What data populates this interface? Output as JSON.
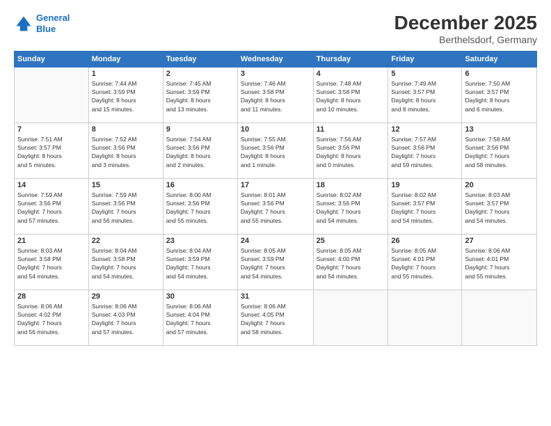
{
  "header": {
    "logo_line1": "General",
    "logo_line2": "Blue",
    "title": "December 2025",
    "subtitle": "Berthelsdorf, Germany"
  },
  "calendar": {
    "days_of_week": [
      "Sunday",
      "Monday",
      "Tuesday",
      "Wednesday",
      "Thursday",
      "Friday",
      "Saturday"
    ],
    "weeks": [
      [
        {
          "day": "",
          "info": ""
        },
        {
          "day": "1",
          "info": "Sunrise: 7:44 AM\nSunset: 3:59 PM\nDaylight: 8 hours\nand 15 minutes."
        },
        {
          "day": "2",
          "info": "Sunrise: 7:45 AM\nSunset: 3:59 PM\nDaylight: 8 hours\nand 13 minutes."
        },
        {
          "day": "3",
          "info": "Sunrise: 7:46 AM\nSunset: 3:58 PM\nDaylight: 8 hours\nand 11 minutes."
        },
        {
          "day": "4",
          "info": "Sunrise: 7:48 AM\nSunset: 3:58 PM\nDaylight: 8 hours\nand 10 minutes."
        },
        {
          "day": "5",
          "info": "Sunrise: 7:49 AM\nSunset: 3:57 PM\nDaylight: 8 hours\nand 8 minutes."
        },
        {
          "day": "6",
          "info": "Sunrise: 7:50 AM\nSunset: 3:57 PM\nDaylight: 8 hours\nand 6 minutes."
        }
      ],
      [
        {
          "day": "7",
          "info": "Sunrise: 7:51 AM\nSunset: 3:57 PM\nDaylight: 8 hours\nand 5 minutes."
        },
        {
          "day": "8",
          "info": "Sunrise: 7:52 AM\nSunset: 3:56 PM\nDaylight: 8 hours\nand 3 minutes."
        },
        {
          "day": "9",
          "info": "Sunrise: 7:54 AM\nSunset: 3:56 PM\nDaylight: 8 hours\nand 2 minutes."
        },
        {
          "day": "10",
          "info": "Sunrise: 7:55 AM\nSunset: 3:56 PM\nDaylight: 8 hours\nand 1 minute."
        },
        {
          "day": "11",
          "info": "Sunrise: 7:56 AM\nSunset: 3:56 PM\nDaylight: 8 hours\nand 0 minutes."
        },
        {
          "day": "12",
          "info": "Sunrise: 7:57 AM\nSunset: 3:56 PM\nDaylight: 7 hours\nand 59 minutes."
        },
        {
          "day": "13",
          "info": "Sunrise: 7:58 AM\nSunset: 3:56 PM\nDaylight: 7 hours\nand 58 minutes."
        }
      ],
      [
        {
          "day": "14",
          "info": "Sunrise: 7:59 AM\nSunset: 3:56 PM\nDaylight: 7 hours\nand 57 minutes."
        },
        {
          "day": "15",
          "info": "Sunrise: 7:59 AM\nSunset: 3:56 PM\nDaylight: 7 hours\nand 56 minutes."
        },
        {
          "day": "16",
          "info": "Sunrise: 8:00 AM\nSunset: 3:56 PM\nDaylight: 7 hours\nand 55 minutes."
        },
        {
          "day": "17",
          "info": "Sunrise: 8:01 AM\nSunset: 3:56 PM\nDaylight: 7 hours\nand 55 minutes."
        },
        {
          "day": "18",
          "info": "Sunrise: 8:02 AM\nSunset: 3:56 PM\nDaylight: 7 hours\nand 54 minutes."
        },
        {
          "day": "19",
          "info": "Sunrise: 8:02 AM\nSunset: 3:57 PM\nDaylight: 7 hours\nand 54 minutes."
        },
        {
          "day": "20",
          "info": "Sunrise: 8:03 AM\nSunset: 3:57 PM\nDaylight: 7 hours\nand 54 minutes."
        }
      ],
      [
        {
          "day": "21",
          "info": "Sunrise: 8:03 AM\nSunset: 3:58 PM\nDaylight: 7 hours\nand 54 minutes."
        },
        {
          "day": "22",
          "info": "Sunrise: 8:04 AM\nSunset: 3:58 PM\nDaylight: 7 hours\nand 54 minutes."
        },
        {
          "day": "23",
          "info": "Sunrise: 8:04 AM\nSunset: 3:59 PM\nDaylight: 7 hours\nand 54 minutes."
        },
        {
          "day": "24",
          "info": "Sunrise: 8:05 AM\nSunset: 3:59 PM\nDaylight: 7 hours\nand 54 minutes."
        },
        {
          "day": "25",
          "info": "Sunrise: 8:05 AM\nSunset: 4:00 PM\nDaylight: 7 hours\nand 54 minutes."
        },
        {
          "day": "26",
          "info": "Sunrise: 8:05 AM\nSunset: 4:01 PM\nDaylight: 7 hours\nand 55 minutes."
        },
        {
          "day": "27",
          "info": "Sunrise: 8:06 AM\nSunset: 4:01 PM\nDaylight: 7 hours\nand 55 minutes."
        }
      ],
      [
        {
          "day": "28",
          "info": "Sunrise: 8:06 AM\nSunset: 4:02 PM\nDaylight: 7 hours\nand 56 minutes."
        },
        {
          "day": "29",
          "info": "Sunrise: 8:06 AM\nSunset: 4:03 PM\nDaylight: 7 hours\nand 57 minutes."
        },
        {
          "day": "30",
          "info": "Sunrise: 8:06 AM\nSunset: 4:04 PM\nDaylight: 7 hours\nand 57 minutes."
        },
        {
          "day": "31",
          "info": "Sunrise: 8:06 AM\nSunset: 4:05 PM\nDaylight: 7 hours\nand 58 minutes."
        },
        {
          "day": "",
          "info": ""
        },
        {
          "day": "",
          "info": ""
        },
        {
          "day": "",
          "info": ""
        }
      ]
    ]
  }
}
